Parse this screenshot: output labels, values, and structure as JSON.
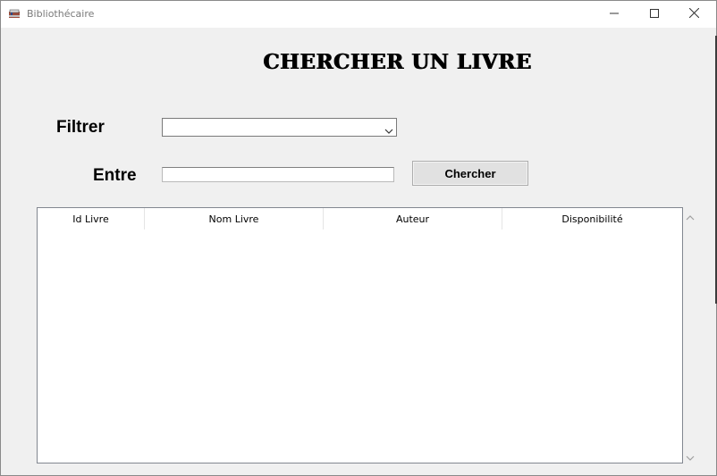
{
  "window": {
    "title": "Bibliothécaire",
    "icon": "books-app-icon",
    "controls": [
      "minimize-icon",
      "maximize-icon",
      "close-icon"
    ]
  },
  "page": {
    "heading": "CHERCHER UN LIVRE"
  },
  "filter": {
    "label": "Filtrer",
    "selected": ""
  },
  "search": {
    "label": "Entre",
    "value": "",
    "placeholder": "",
    "button_label": "Chercher"
  },
  "table": {
    "columns": [
      "Id Livre",
      "Nom Livre",
      "Auteur",
      "Disponibilité"
    ],
    "rows": []
  },
  "colors": {
    "window_bg": "#f0f0f0",
    "titlebar_bg": "#ffffff",
    "button_bg": "#e1e1e1"
  }
}
